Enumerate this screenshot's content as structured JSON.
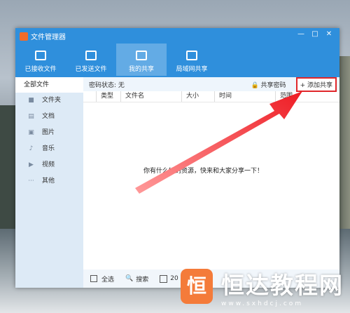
{
  "window": {
    "title": "文件管理器",
    "controls": [
      "—",
      "□",
      "✕"
    ]
  },
  "toolbar": {
    "items": [
      {
        "label": "已接收文件",
        "icon": "received-files-icon"
      },
      {
        "label": "已发送文件",
        "icon": "sent-files-icon"
      },
      {
        "label": "我的共享",
        "icon": "my-share-icon",
        "active": true
      },
      {
        "label": "局域网共享",
        "icon": "lan-share-icon"
      }
    ]
  },
  "sidebar": {
    "all_files": "全部文件",
    "items": [
      {
        "label": "文件夹",
        "icon": "folder-icon"
      },
      {
        "label": "文档",
        "icon": "document-icon"
      },
      {
        "label": "图片",
        "icon": "image-icon"
      },
      {
        "label": "音乐",
        "icon": "music-icon"
      },
      {
        "label": "视频",
        "icon": "video-icon"
      },
      {
        "label": "其他",
        "icon": "more-icon"
      }
    ]
  },
  "main": {
    "password_status": "密码状态: 无",
    "share_password": "共享密码",
    "add_share": "添加共享",
    "columns": [
      "类型",
      "文件名",
      "大小",
      "时间",
      "范围"
    ],
    "empty_message": "你有什么好的资源，快来和大家分享一下！"
  },
  "footer": {
    "select_all": "全选",
    "search": "搜索",
    "date_partial": "20"
  },
  "watermark": {
    "brand": "恒达教程网",
    "logo_char": "恒",
    "url": "www.sxhdcj.com"
  },
  "colors": {
    "accent": "#2f8fdc",
    "highlight": "#e0262a",
    "brand": "#f47b3a"
  }
}
